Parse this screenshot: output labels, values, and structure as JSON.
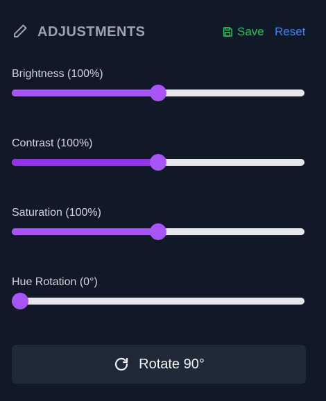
{
  "header": {
    "title": "ADJUSTMENTS",
    "icon": "pencil-icon",
    "save_label": "Save",
    "save_icon": "floppy-disk-icon",
    "reset_label": "Reset"
  },
  "sliders": [
    {
      "label": "Brightness (100%)",
      "value": 100,
      "min": 0,
      "max": 200,
      "fraction": 0.5
    },
    {
      "label": "Contrast (100%)",
      "value": 100,
      "min": 0,
      "max": 200,
      "fraction": 0.5
    },
    {
      "label": "Saturation (100%)",
      "value": 100,
      "min": 0,
      "max": 200,
      "fraction": 0.5
    },
    {
      "label": "Hue Rotation (0°)",
      "value": 0,
      "min": 0,
      "max": 360,
      "fraction": 0.0
    }
  ],
  "rotate_button": {
    "label": "Rotate 90°",
    "icon": "rotate-clockwise-icon"
  },
  "colors": {
    "background": "#111827",
    "slider_accent": "#a855f7",
    "slider_track": "#e5e7eb",
    "save": "#22c55e",
    "reset": "#3b82f6",
    "button_bg": "#1f2937"
  }
}
